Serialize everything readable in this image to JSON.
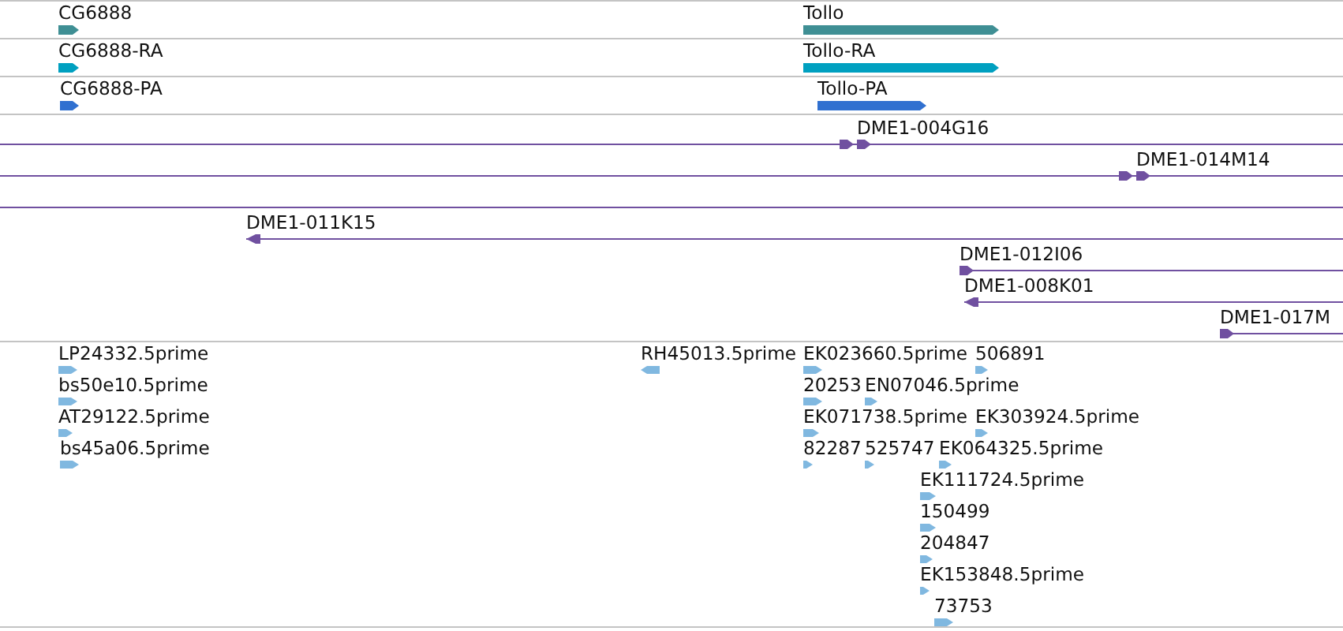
{
  "tracks": [
    {
      "kind": "gene",
      "color": "#3f8f94",
      "features": [
        {
          "label": "CG6888",
          "reverse": false
        },
        {
          "label": "Tollo",
          "reverse": false
        }
      ]
    },
    {
      "kind": "gene",
      "color": "#00a0c0",
      "features": [
        {
          "label": "CG6888-RA",
          "reverse": false
        },
        {
          "label": "Tollo-RA",
          "reverse": false
        }
      ]
    },
    {
      "kind": "gene",
      "color": "#3070d0",
      "features": [
        {
          "label": "CG6888-PA",
          "reverse": false
        },
        {
          "label": "Tollo-PA",
          "reverse": false
        }
      ]
    },
    {
      "kind": "clone",
      "color": "#7050a0",
      "features": [
        {
          "label": "DME1-004G16",
          "reverse": false
        },
        {
          "label": "DME1-014M14",
          "reverse": false
        },
        {
          "label": "DME1-011K15",
          "reverse": true
        },
        {
          "label": "DME1-012I06",
          "reverse": false
        },
        {
          "label": "DME1-008K01",
          "reverse": true
        },
        {
          "label": "DME1-017M",
          "reverse": false
        }
      ]
    },
    {
      "kind": "est",
      "color": "#80b8e0",
      "features": [
        {
          "label": "LP24332.5prime",
          "reverse": false
        },
        {
          "label": "RH45013.5prime",
          "reverse": true
        },
        {
          "label": "EK023660.5prime",
          "reverse": false
        },
        {
          "label": "506891",
          "reverse": false
        },
        {
          "label": "bs50e10.5prime",
          "reverse": false
        },
        {
          "label": "20253",
          "reverse": false
        },
        {
          "label": "EN07046.5prime",
          "reverse": false
        },
        {
          "label": "AT29122.5prime",
          "reverse": false
        },
        {
          "label": "EK071738.5prime",
          "reverse": false
        },
        {
          "label": "EK303924.5prime",
          "reverse": false
        },
        {
          "label": "bs45a06.5prime",
          "reverse": false
        },
        {
          "label": "82287",
          "reverse": false
        },
        {
          "label": "525747",
          "reverse": false
        },
        {
          "label": "EK064325.5prime",
          "reverse": false
        },
        {
          "label": "EK111724.5prime",
          "reverse": false
        },
        {
          "label": "150499",
          "reverse": false
        },
        {
          "label": "204847",
          "reverse": false
        },
        {
          "label": "EK153848.5prime",
          "reverse": false
        },
        {
          "label": "73753",
          "reverse": false
        }
      ]
    }
  ]
}
